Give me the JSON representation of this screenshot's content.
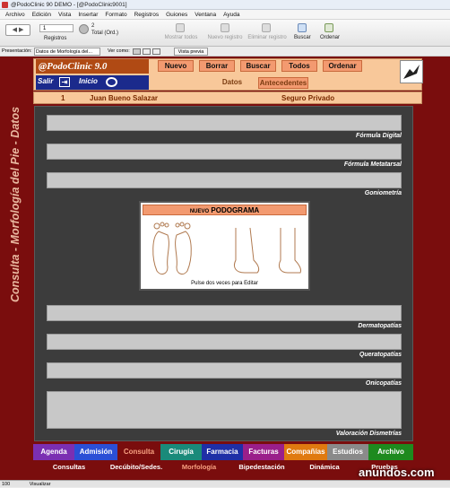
{
  "window": {
    "title": "@PodoClinic 90 DEMO - [@PodoClinic9001]"
  },
  "menu": [
    "Archivo",
    "Edición",
    "Vista",
    "Insertar",
    "Formato",
    "Registros",
    "Guiones",
    "Ventana",
    "Ayuda"
  ],
  "toolbar": {
    "record_number": "1",
    "found": "2",
    "total": "Total (Ord.)",
    "registros_label": "Registros",
    "mostrar_todos": "Mostrar todos",
    "nuevo_registro": "Nuevo registro",
    "eliminar_registro": "Eliminar registro",
    "buscar": "Buscar",
    "ordenar": "Ordenar"
  },
  "layoutbar": {
    "presentacion_label": "Presentación:",
    "presentacion_value": "Datos de Morfología del...",
    "ver_como_label": "Ver como:",
    "vista_previa": "Vista previa"
  },
  "side_title": "Consulta - Morfología del Pie - Datos",
  "header": {
    "logo": "@PodoClinic 9.0",
    "buttons": [
      "Nuevo",
      "Borrar",
      "Buscar",
      "Todos",
      "Ordenar"
    ],
    "salir": "Salir",
    "inicio": "Inicio",
    "tab_datos": "Datos",
    "tab_antecedentes": "Antecedentes"
  },
  "patient": {
    "id": "1",
    "name": "Juan Bueno Salazar",
    "insurer": "Seguro Privado"
  },
  "fields": [
    "Fórmula Digital",
    "Fórmula Metatarsal",
    "Goniometría",
    "Dermatopatías",
    "Queratopatías",
    "Onicopatías",
    "Valoración Dismetrías"
  ],
  "podograma": {
    "title_small": "NUEVO",
    "title": "PODOGRAMA",
    "caption": "Pulse dos veces para Editar"
  },
  "tabs_main": [
    {
      "label": "Agenda",
      "color": "#7b2fb2"
    },
    {
      "label": "Admisión",
      "color": "#2b4fd6"
    },
    {
      "label": "Consulta",
      "color": "#7a0d0d"
    },
    {
      "label": "Cirugía",
      "color": "#1a8a7a"
    },
    {
      "label": "Farmacia",
      "color": "#1f2fa6"
    },
    {
      "label": "Facturas",
      "color": "#9a1f8a"
    },
    {
      "label": "Compañías",
      "color": "#e07a10"
    },
    {
      "label": "Estudios",
      "color": "#8a8a8a"
    },
    {
      "label": "Archivo",
      "color": "#1e8a1e"
    }
  ],
  "tabs_sub": [
    "Consultas",
    "Decúbito/Sedes.",
    "Morfología",
    "Bipedestación",
    "Dinámica",
    "Pruebas"
  ],
  "statusbar": {
    "zoom": "100",
    "mode": "Visualizar"
  },
  "watermark": "anundos.com"
}
